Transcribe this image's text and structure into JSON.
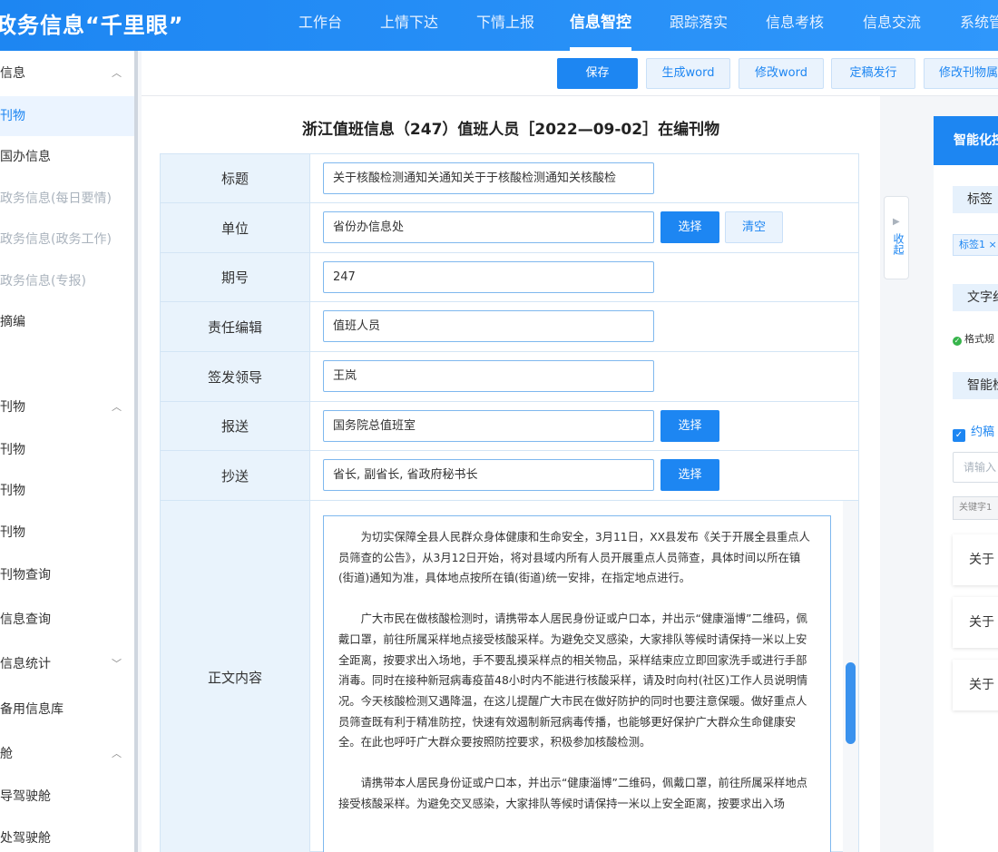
{
  "app": {
    "title": "政务信息“千里眼”"
  },
  "nav": {
    "items": [
      "工作台",
      "上情下达",
      "下情上报",
      "信息智控",
      "跟踪落实",
      "信息考核",
      "信息交流",
      "系统管"
    ],
    "active": "信息智控"
  },
  "sidebar": {
    "items": [
      {
        "label": "信息",
        "type": "group"
      },
      {
        "label": "刊物",
        "type": "item",
        "active": true
      },
      {
        "label": "国办信息",
        "type": "item"
      },
      {
        "label": "政务信息(每日要情)",
        "type": "item"
      },
      {
        "label": "政务信息(政务工作)",
        "type": "item"
      },
      {
        "label": "政务信息(专报)",
        "type": "item"
      },
      {
        "label": "摘编",
        "type": "item"
      },
      {
        "label": "刊物",
        "type": "group"
      },
      {
        "label": "刊物",
        "type": "item"
      },
      {
        "label": "刊物",
        "type": "item"
      },
      {
        "label": "刊物",
        "type": "item"
      },
      {
        "label": "刊物查询",
        "type": "item"
      },
      {
        "label": "信息查询",
        "type": "item"
      },
      {
        "label": "信息统计",
        "type": "group"
      },
      {
        "label": "备用信息库",
        "type": "item"
      },
      {
        "label": "舱",
        "type": "group"
      },
      {
        "label": "导驾驶舱",
        "type": "item"
      },
      {
        "label": "处驾驶舱",
        "type": "item"
      }
    ]
  },
  "toolbar": {
    "save": "保存",
    "gen_word": "生成word",
    "edit_word": "修改word",
    "finalize": "定稿发行",
    "edit_props": "修改刊物属性"
  },
  "doc": {
    "title": "浙江值班信息（247）值班人员［2022—09-02］在编刊物"
  },
  "form": {
    "title_label": "标题",
    "title_value": "关于核酸检测通知关通知关于于核酸检测通知关核酸检",
    "unit_label": "单位",
    "unit_value": "省份办信息处",
    "issue_label": "期号",
    "issue_value": "247",
    "editor_label": "责任编辑",
    "editor_value": "值班人员",
    "leader_label": "签发领导",
    "leader_value": "王岚",
    "send_label": "报送",
    "send_value": "国务院总值班室",
    "cc_label": "抄送",
    "cc_value": "省长, 副省长, 省政府秘书长",
    "content_label": "正文内容",
    "select_btn": "选择",
    "clear_btn": "清空",
    "paragraphs": [
      "为切实保障全县人民群众身体健康和生命安全，3月11日，XX县发布《关于开展全县重点人员筛查的公告》，从3月12日开始，将对县域内所有人员开展重点人员筛查，具体时间以所在镇(街道)通知为准，具体地点按所在镇(街道)统一安排，在指定地点进行。",
      "广大市民在做核酸检测时，请携带本人居民身份证或户口本，并出示“健康淄博”二维码，佩戴口罩，前往所属采样地点接受核酸采样。为避免交叉感染，大家排队等候时请保持一米以上安全距离，按要求出入场地，手不要乱摸采样点的相关物品，采样结束应立即回家洗手或进行手部消毒。同时在接种新冠病毒疫苗48小时内不能进行核酸采样，请及时向村(社区)工作人员说明情况。今天核酸检测又遇降温，在这儿提醒广大市民在做好防护的同时也要注意保暖。做好重点人员筛查既有利于精准防控，快速有效遏制新冠病毒传播，也能够更好保护广大群众生命健康安全。在此也呼吁广大群众要按照防控要求，积极参加核酸检测。",
      "请携带本人居民身份证或户口本，并出示“健康淄博”二维码，佩戴口罩，前往所属采样地点接受核酸采样。为避免交叉感染，大家排队等候时请保持一米以上安全距离，按要求出入场"
    ]
  },
  "collapse": {
    "label": "收起"
  },
  "right_panel": {
    "header": "智能化控",
    "tags_section": "标签",
    "tag1": "标签1 ×",
    "text_section": "文字纠",
    "format_ok": "格式规",
    "smart_section": "智能检",
    "checkbox_label": "约稿",
    "input_placeholder": "请输入",
    "keyword": "关键字1",
    "results": [
      "关于",
      "关于",
      "关于"
    ]
  },
  "colors": {
    "primary": "#1d86f2",
    "label_bg": "#e9f3fc",
    "border": "#d3e5f5"
  },
  "icons": [
    "chevron-up-icon",
    "chevron-down-icon",
    "collapse-arrow-icon",
    "check-circle-icon",
    "checkbox-icon"
  ]
}
